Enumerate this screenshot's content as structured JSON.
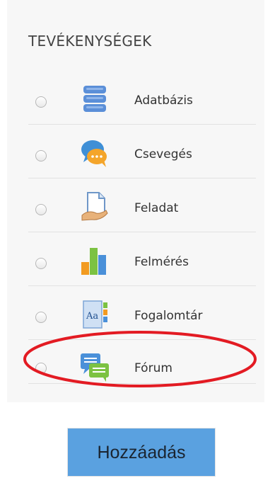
{
  "section": {
    "title": "TEVÉKENYSÉGEK"
  },
  "activities": [
    {
      "label": "Adatbázis",
      "icon": "database-icon"
    },
    {
      "label": "Csevegés",
      "icon": "chat-icon"
    },
    {
      "label": "Feladat",
      "icon": "assignment-icon"
    },
    {
      "label": "Felmérés",
      "icon": "survey-chart-icon"
    },
    {
      "label": "Fogalomtár",
      "icon": "glossary-icon"
    },
    {
      "label": "Fórum",
      "icon": "forum-icon"
    }
  ],
  "actions": {
    "add_label": "Hozzáadás"
  },
  "colors": {
    "panel_bg": "#f7f7f7",
    "button_bg": "#5aa1e0",
    "highlight_annotation": "#e31b23"
  }
}
